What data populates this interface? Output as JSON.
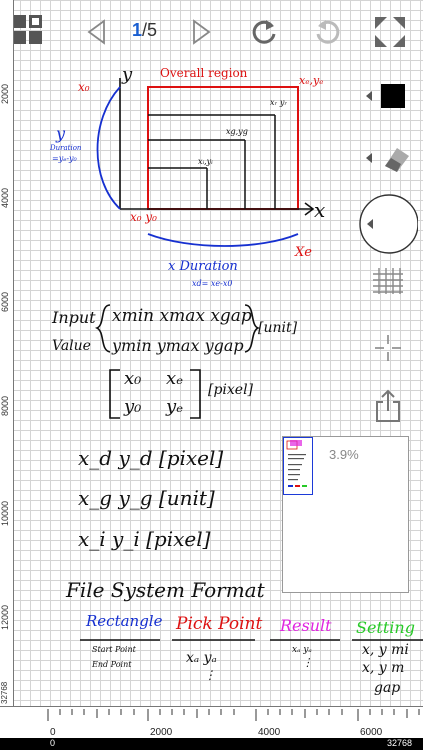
{
  "toolbar": {
    "page_current": "1",
    "page_total": "/5",
    "icons": [
      "grid-menu-icon",
      "arrow-left-icon",
      "arrow-right-icon",
      "undo-icon",
      "redo-icon",
      "fullscreen-icon"
    ]
  },
  "rulers": {
    "vertical": [
      "2000",
      "4000",
      "6000",
      "8000",
      "10000",
      "12000",
      "32768"
    ],
    "horizontal": [
      "0",
      "2000",
      "4000",
      "6000"
    ],
    "bottom_bar": [
      "0",
      "32768"
    ]
  },
  "minimap": {
    "zoom": "3.9%"
  },
  "colors": {
    "accent": "#1a5fd1",
    "red": "#d11",
    "blue": "#1630d0",
    "magenta": "#e024e0",
    "green": "#27c927"
  },
  "notes": {
    "overall_region": "Overall region",
    "xe_ye": "xₑ,yₑ",
    "x0": "x₀",
    "y": "y",
    "x0_y0": "x₀ y₀",
    "x_axis": "x",
    "xe": "Xe",
    "xr_yr": "xᵣ yᵣ",
    "xg_yg": "x𝑔,y𝑔",
    "xi_yi": "xᵢ,yᵢ",
    "y_duration": "y",
    "duration_label": "Duration",
    "y_formula": "=yₑ-y₀",
    "x_duration": "x Duration",
    "x_formula": "xd= xe-x0",
    "input": "Input",
    "value": "Value",
    "row1": "xmin  xmax  xgap",
    "row2": "ymin  ymax  ygap",
    "unit1": "[unit]",
    "mat_x0": "x₀",
    "mat_xe": "xₑ",
    "mat_y0": "y₀",
    "mat_ye": "yₑ",
    "pixel1": "[pixel]",
    "line1": "x_d y_d  [pixel]",
    "line2": "x_g y_g  [unit]",
    "line3": "x_i y_i  [pixel]",
    "file_format": "File  System  Format",
    "rectangle": "Rectangle",
    "pick_point": "Pick Point",
    "result": "Result",
    "setting": "Setting",
    "start_point": "Start Point",
    "end_point": "End Point",
    "pick_xy": "xₐ yₐ",
    "result_xy": "xₐ yₐ",
    "setting_1": "x, y  mi",
    "setting_2": "x, y  m",
    "setting_3": "gap"
  }
}
